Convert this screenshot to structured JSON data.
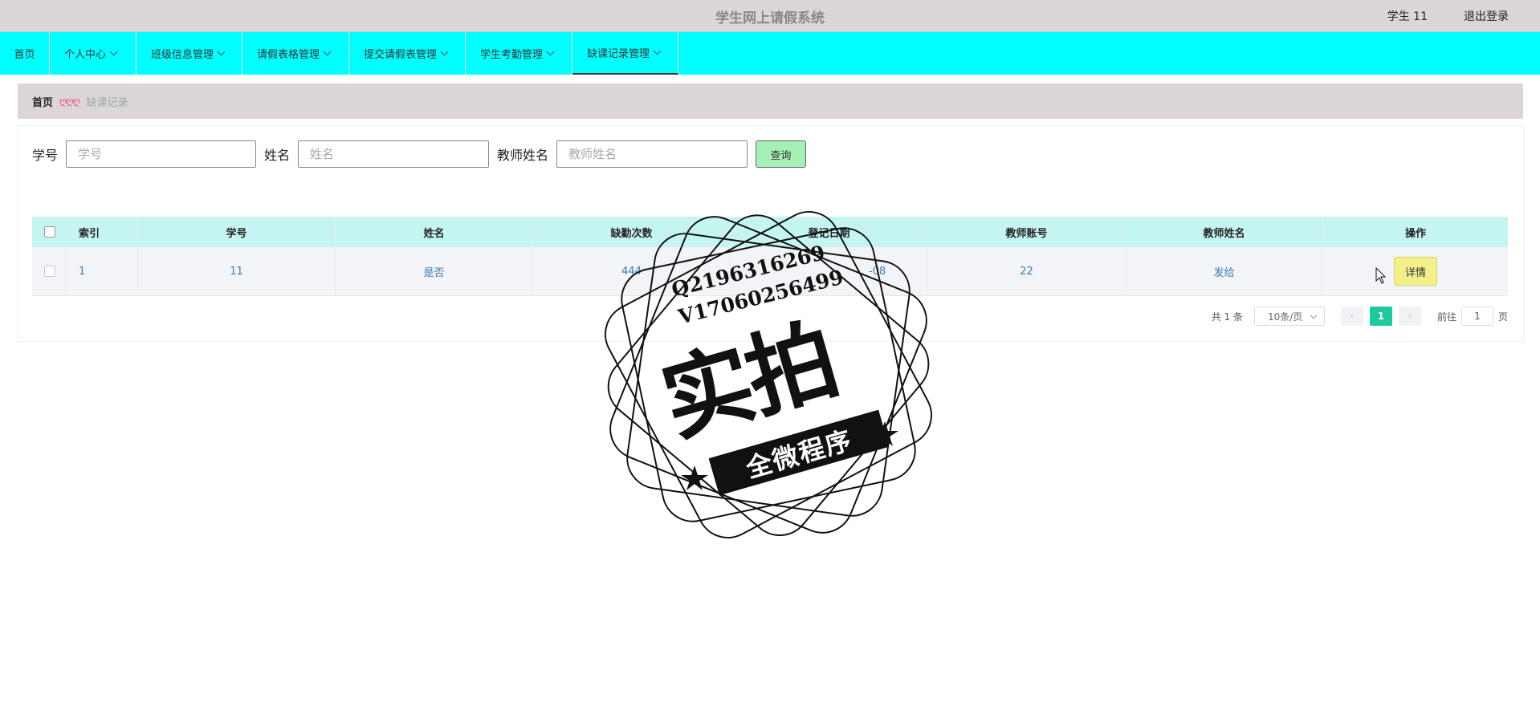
{
  "header": {
    "title": "学生网上请假系统",
    "user": "学生 11",
    "logout": "退出登录"
  },
  "nav": [
    {
      "label": "首页",
      "dropdown": false
    },
    {
      "label": "个人中心",
      "dropdown": true
    },
    {
      "label": "班级信息管理",
      "dropdown": true
    },
    {
      "label": "请假表格管理",
      "dropdown": true
    },
    {
      "label": "提交请假表管理",
      "dropdown": true
    },
    {
      "label": "学生考勤管理",
      "dropdown": true
    },
    {
      "label": "缺课记录管理",
      "dropdown": true,
      "active": true
    }
  ],
  "breadcrumb": {
    "home": "首页",
    "separator": "ღღღ",
    "current": "缺课记录"
  },
  "search": {
    "student_no_label": "学号",
    "student_no_placeholder": "学号",
    "name_label": "姓名",
    "name_placeholder": "姓名",
    "teacher_label": "教师姓名",
    "teacher_placeholder": "教师姓名",
    "query_button": "查询"
  },
  "table": {
    "columns": [
      "索引",
      "学号",
      "姓名",
      "缺勤次数",
      "登记日期",
      "教师账号",
      "教师姓名",
      "操作"
    ],
    "rows": [
      {
        "index": "1",
        "student_no": "11",
        "name": "是否",
        "absences": "444",
        "date": "-08",
        "teacher_account": "22",
        "teacher_name": "发给",
        "action": "详情"
      }
    ]
  },
  "pagination": {
    "total": "共 1 条",
    "page_size": "10条/页",
    "current": "1",
    "goto_label": "前往",
    "goto_value": "1",
    "page_suffix": "页"
  },
  "watermark": {
    "line1": "Q2196316269",
    "line2": "V17060256499",
    "main": "实拍",
    "band": "全微程序"
  },
  "colors": {
    "nav_bg": "#00ffff",
    "topbar_bg": "#dcd6d6",
    "table_header_bg": "#c4f5f0",
    "query_btn": "#a6f0b6",
    "detail_btn": "#f3f08a",
    "page_active": "#1fc9a0"
  }
}
